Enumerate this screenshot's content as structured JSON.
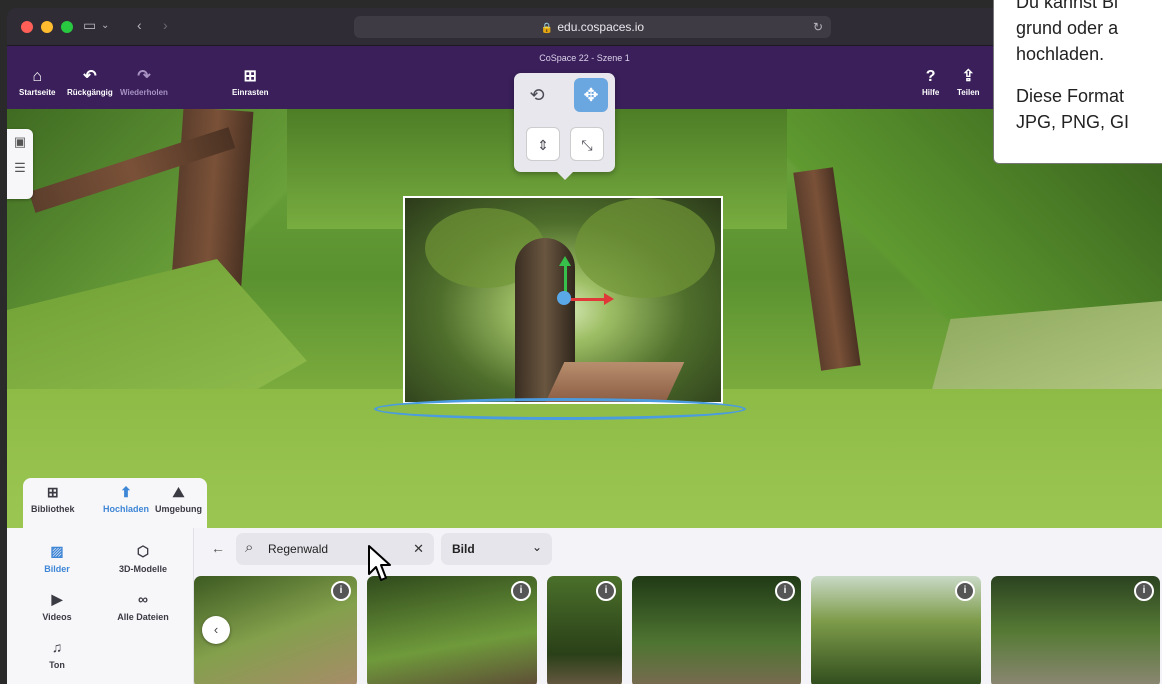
{
  "browser": {
    "url": "edu.cospaces.io",
    "icons": [
      "sidebar-icon",
      "back-icon",
      "forward-icon",
      "lock-icon",
      "reload-icon"
    ]
  },
  "header": {
    "scene_title": "CoSpace 22 - Szene 1",
    "home_label": "Startseite",
    "undo_label": "Rückgängig",
    "redo_label": "Wiederholen",
    "snap_label": "Einrasten",
    "help_label": "Hilfe",
    "share_label": "Teilen"
  },
  "bottom_tabs": {
    "library": "Bibliothek",
    "upload": "Hochladen",
    "environment": "Umgebung",
    "active": "upload"
  },
  "categories": {
    "images": "Bilder",
    "models": "3D-Modelle",
    "videos": "Videos",
    "all_files": "Alle Dateien",
    "sound": "Ton",
    "active": "images"
  },
  "search": {
    "value": "Regenwald"
  },
  "type_filter": {
    "selected": "Bild"
  },
  "thumbnails": [
    {
      "name": "rainforest-photo-1"
    },
    {
      "name": "rainforest-photo-2"
    },
    {
      "name": "rainforest-photo-3"
    },
    {
      "name": "rainforest-photo-4"
    },
    {
      "name": "rainforest-photo-5"
    },
    {
      "name": "rainforest-photo-6"
    }
  ],
  "tooltip": {
    "line1": "Du kannst Bi",
    "line2": "grund oder a",
    "line3": "hochladen.",
    "line4": "Diese Format",
    "line5": "JPG, PNG, GI"
  },
  "colors": {
    "accent": "#3e86d6",
    "header_bg": "#3a1f5a",
    "gizmo_active": "#6aa7e0"
  }
}
